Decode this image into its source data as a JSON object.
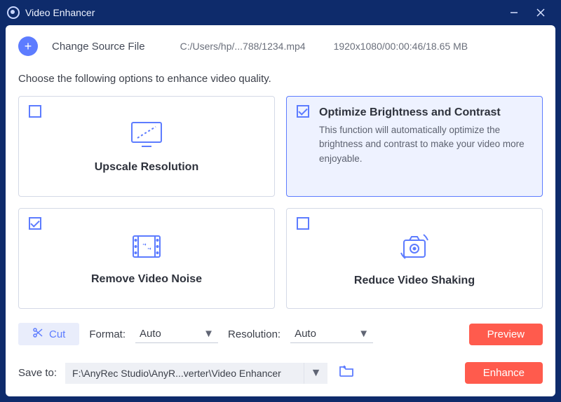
{
  "titlebar": {
    "app_name": "Video Enhancer"
  },
  "source": {
    "change_label": "Change Source File",
    "path": "C:/Users/hp/...788/1234.mp4",
    "meta": "1920x1080/00:00:46/18.65 MB"
  },
  "instruction": "Choose the following options to enhance video quality.",
  "options": {
    "upscale": {
      "title": "Upscale Resolution",
      "checked": false
    },
    "optimize": {
      "title": "Optimize Brightness and Contrast",
      "checked": true,
      "desc": "This function will automatically optimize the brightness and contrast to make your video more enjoyable."
    },
    "denoise": {
      "title": "Remove Video Noise",
      "checked": true
    },
    "deshake": {
      "title": "Reduce Video Shaking",
      "checked": false
    }
  },
  "controls": {
    "cut_label": "Cut",
    "format_label": "Format:",
    "format_value": "Auto",
    "resolution_label": "Resolution:",
    "resolution_value": "Auto",
    "preview_label": "Preview"
  },
  "save": {
    "label": "Save to:",
    "path": "F:\\AnyRec Studio\\AnyR...verter\\Video Enhancer",
    "enhance_label": "Enhance"
  }
}
